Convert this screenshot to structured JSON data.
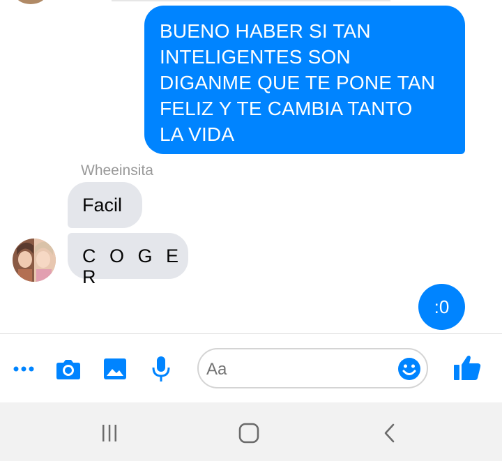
{
  "conversation": {
    "messages": [
      {
        "direction": "outgoing",
        "text": "BUENO HABER SI TAN INTELIGENTES SON DIGANME QUE TE PONE TAN FELIZ Y TE CAMBIA TANTO LA VIDA"
      },
      {
        "direction": "incoming",
        "sender": "Wheeinsita",
        "text": "Facil"
      },
      {
        "direction": "incoming",
        "sender": "Wheeinsita",
        "text": "C O G E R"
      },
      {
        "direction": "outgoing",
        "text": ":0"
      }
    ],
    "outgoing_lines": [
      "BUENO HABER SI TAN",
      "INTELIGENTES SON",
      "DIGANME QUE TE PONE TAN",
      "FELIZ Y TE CAMBIA TANTO",
      "LA VIDA"
    ],
    "sender_name": "Wheeinsita"
  },
  "composer": {
    "placeholder": "Aa",
    "icons": [
      "more-icon",
      "camera-icon",
      "gallery-icon",
      "microphone-icon",
      "emoji-icon",
      "thumbs-up-icon"
    ]
  },
  "navigation": {
    "icons": [
      "recents-icon",
      "home-icon",
      "back-icon"
    ]
  },
  "colors": {
    "accent": "#0084ff",
    "incoming_bubble": "#e4e6eb",
    "background": "#ffffff",
    "nav_background": "#f2f2f2"
  }
}
